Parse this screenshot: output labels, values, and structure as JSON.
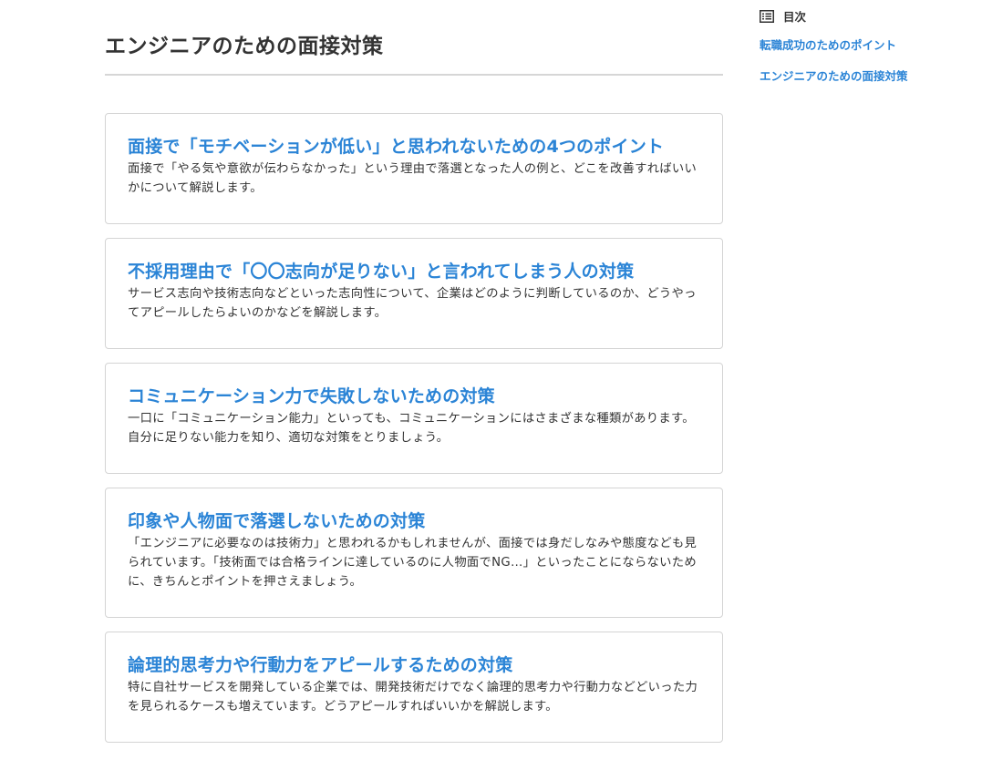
{
  "main": {
    "title": "エンジニアのための面接対策",
    "articles": [
      {
        "title": "面接で「モチベーションが低い」と思われないための4つのポイント",
        "description": "面接で「やる気や意欲が伝わらなかった」という理由で落選となった人の例と、どこを改善すればいいかについて解説します。"
      },
      {
        "title": "不採用理由で「〇〇志向が足りない」と言われてしまう人の対策",
        "description": "サービス志向や技術志向などといった志向性について、企業はどのように判断しているのか、どうやってアピールしたらよいのかなどを解説します。"
      },
      {
        "title": "コミュニケーション力で失敗しないための対策",
        "description": "一口に「コミュニケーション能力」といっても、コミュニケーションにはさまざまな種類があります。自分に足りない能力を知り、適切な対策をとりましょう。"
      },
      {
        "title": "印象や人物面で落選しないための対策",
        "description": "「エンジニアに必要なのは技術力」と思われるかもしれませんが、面接では身だしなみや態度なども見られています。「技術面では合格ラインに達しているのに人物面でNG…」といったことにならないために、きちんとポイントを押さえましょう。"
      },
      {
        "title": "論理的思考力や行動力をアピールするための対策",
        "description": "特に自社サービスを開発している企業では、開発技術だけでなく論理的思考力や行動力などどいった力を見られるケースも増えています。どうアピールすればいいかを解説します。"
      }
    ]
  },
  "toc": {
    "icon": "list-icon",
    "title": "目次",
    "links": [
      "転職成功のためのポイント",
      "エンジニアのための面接対策"
    ]
  },
  "colors": {
    "accent": "#2b84d6",
    "text": "#333333",
    "border": "#d4d4d4",
    "rule": "#d6d6d6"
  }
}
